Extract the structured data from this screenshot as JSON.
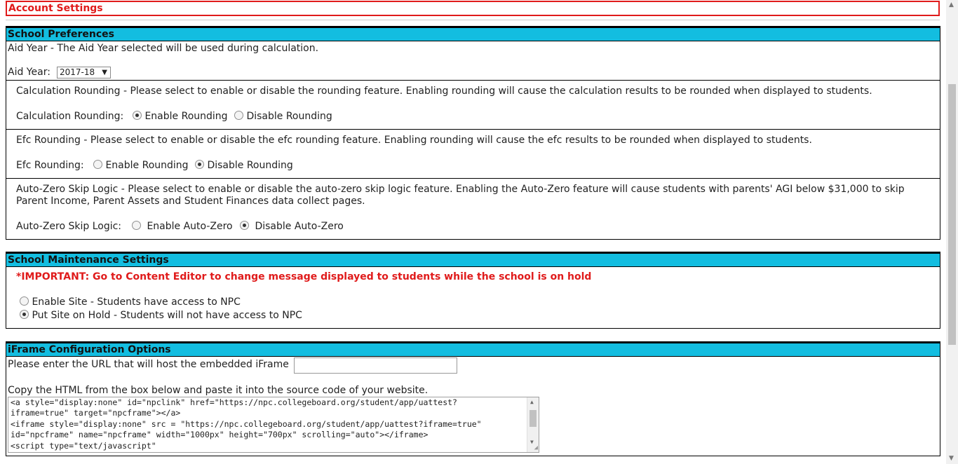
{
  "page_title": "Account Settings",
  "school_preferences": {
    "header": "School Preferences",
    "aid_year": {
      "description": "Aid Year - The Aid Year selected will be used during calculation.",
      "label": "Aid Year:",
      "selected": "2017-18"
    },
    "calculation_rounding": {
      "description": "Calculation Rounding - Please select to enable or disable the rounding feature. Enabling rounding will cause the calculation results to be rounded when displayed to students.",
      "label": "Calculation Rounding:",
      "option_enable": "Enable Rounding",
      "option_disable": "Disable Rounding",
      "selected": "enable"
    },
    "efc_rounding": {
      "description": "Efc Rounding - Please select to enable or disable the efc rounding feature. Enabling rounding will cause the efc results to be rounded when displayed to students.",
      "label": "Efc Rounding:",
      "option_enable": "Enable Rounding",
      "option_disable": "Disable Rounding",
      "selected": "disable"
    },
    "auto_zero": {
      "description_line1": "Auto-Zero Skip Logic - Please select to enable or disable the auto-zero skip logic feature. Enabling the Auto-Zero feature will cause students with parents' AGI below $31,000 to skip",
      "description_line2": "Parent Income, Parent Assets and Student Finances data collect pages.",
      "label": "Auto-Zero Skip Logic:",
      "option_enable": "Enable Auto-Zero",
      "option_disable": "Disable Auto-Zero",
      "selected": "disable"
    }
  },
  "maintenance": {
    "header": "School Maintenance Settings",
    "important": "*IMPORTANT: Go to Content Editor to change message displayed to students while the school is on hold",
    "option_enable": "Enable Site - Students have access to NPC",
    "option_hold": "Put Site on Hold - Students will not have access to NPC",
    "selected": "hold"
  },
  "iframe": {
    "header": "iFrame Configuration Options",
    "url_label": "Please enter the URL that will host the embedded iFrame",
    "url_value": "",
    "copy_label": "Copy the HTML from the box below and paste it into the source code of your website.",
    "code_lines": [
      "<a style=\"display:none\" id=\"npclink\" href=\"https://npc.collegeboard.org/student/app/uattest?",
      "iframe=true\" target=\"npcframe\"></a>",
      "<iframe style=\"display:none\" src = \"https://npc.collegeboard.org/student/app/uattest?iframe=true\"",
      "id=\"npcframe\" name=\"npcframe\" width=\"1000px\" height=\"700px\" scrolling=\"auto\"></iframe>",
      "<script type=\"text/javascript\""
    ]
  }
}
